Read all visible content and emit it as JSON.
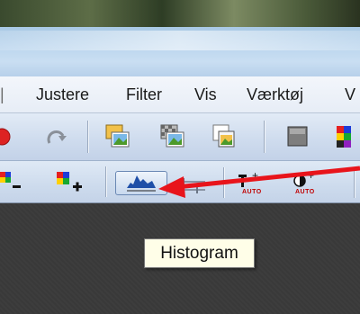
{
  "menu": {
    "items": [
      "Justere",
      "Filter",
      "Vis",
      "Værktøj",
      "V"
    ]
  },
  "toolbar2": {
    "auto_label_1": "AUTO",
    "auto_label_2": "AUTO",
    "plus_sign": "+"
  },
  "tooltip": {
    "text": "Histogram"
  },
  "colors": {
    "arrow": "#e8141b",
    "tooltip_bg": "#fffee8",
    "menubar_bg": "#eef2f8"
  },
  "icons": [
    "undo-icon",
    "redo-icon",
    "image-icon",
    "mask-image-icon",
    "copy-image-icon",
    "gray-square-icon",
    "color-grid-icon",
    "remove-color-icon",
    "add-color-icon",
    "histogram-icon",
    "levels-icon",
    "auto-levels-icon",
    "auto-contrast-icon"
  ]
}
